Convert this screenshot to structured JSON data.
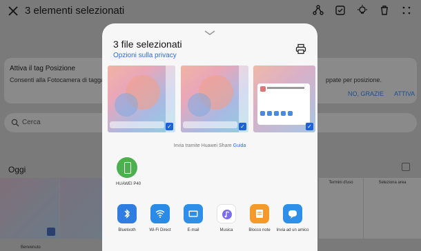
{
  "background": {
    "title": "3 elementi selezionati",
    "tag_card": {
      "title": "Attiva il tag Posizione",
      "desc": "Consenti alla Fotocamera di taggar",
      "desc_right": "ppate per posizione.",
      "no_label": "NO, GRAZIE",
      "yes_label": "ATTIVA"
    },
    "search_placeholder": "Cerca",
    "today_label": "Oggi",
    "thumb_title_right1": "Termini d'uso",
    "thumb_title_right2": "Seleziona area",
    "bottom_label": "Benvenuto"
  },
  "sheet": {
    "title": "3 file selezionati",
    "privacy_link": "Opzioni sulla privacy",
    "huawei_share_text": "Invia tramite Huawei Share",
    "huawei_share_link": "Guida",
    "device_label": "HUAWEI P40",
    "apps": [
      {
        "label": "Bluetooth",
        "color": "#2f7de1"
      },
      {
        "label": "Wi-Fi Direct",
        "color": "#2a8ae6"
      },
      {
        "label": "E-mail",
        "color": "#2f8fe8"
      },
      {
        "label": "Musica",
        "color": "#ffffff"
      },
      {
        "label": "Blocco note",
        "color": "#f39a2b"
      },
      {
        "label": "Invia ad un amico",
        "color": "#2f8fe8"
      }
    ]
  },
  "colors": {
    "accent": "#2a6fd6",
    "device_green": "#4caf50"
  }
}
